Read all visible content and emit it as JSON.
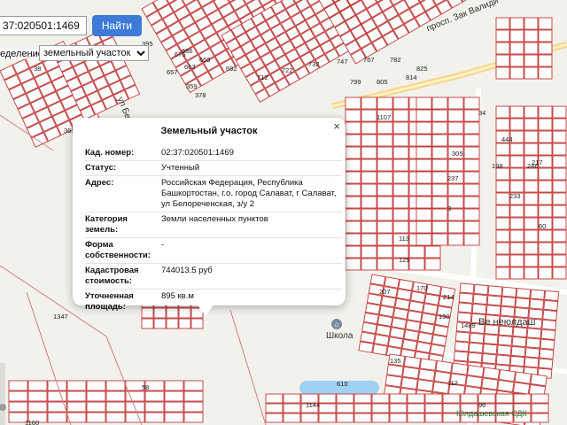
{
  "search": {
    "value": "37:020501:1469",
    "button": "Найти"
  },
  "layer": {
    "label": "еделение:",
    "selected": "земельный участок"
  },
  "popup": {
    "title": "Земельный участок",
    "close": "×",
    "rows": [
      {
        "key": "Кад. номер:",
        "value": "02:37:020501:1469"
      },
      {
        "key": "Статус:",
        "value": "Учтенный"
      },
      {
        "key": "Адрес:",
        "value": "Российская Федерация, Республика Башкортостан, г.о. город Салават, г Салават, ул Белореченская, з/у 2"
      },
      {
        "key": "Категория земель:",
        "value": "Земли населенных пунктов"
      },
      {
        "key": "Форма собственности:",
        "value": "-"
      },
      {
        "key": "Кадастровая стоимость:",
        "value": "744013.5 руб"
      },
      {
        "key": "Уточненная площадь:",
        "value": "895 кв.м"
      }
    ]
  },
  "map": {
    "road_label": "просп. Зак Валиди",
    "street_label": "ул Белореченская",
    "school_label": "Школа",
    "place_label": "Ве    неюлдаш",
    "bottom_label": "Юлдашевская СДК",
    "parcel_numbers": [
      "686",
      "669",
      "692",
      "712",
      "722",
      "732",
      "747",
      "767",
      "782",
      "799",
      "805",
      "814",
      "825",
      "1107",
      "1160",
      "305",
      "237",
      "3",
      "113",
      "129",
      "207",
      "170",
      "214",
      "130",
      "135",
      "610",
      "1144",
      "198",
      "246",
      "395",
      "675",
      "663",
      "657",
      "359",
      "378",
      "363",
      "38",
      "1347",
      "58",
      "34",
      "444",
      "217",
      "233",
      "60",
      "1489",
      "112",
      "96"
    ]
  }
}
